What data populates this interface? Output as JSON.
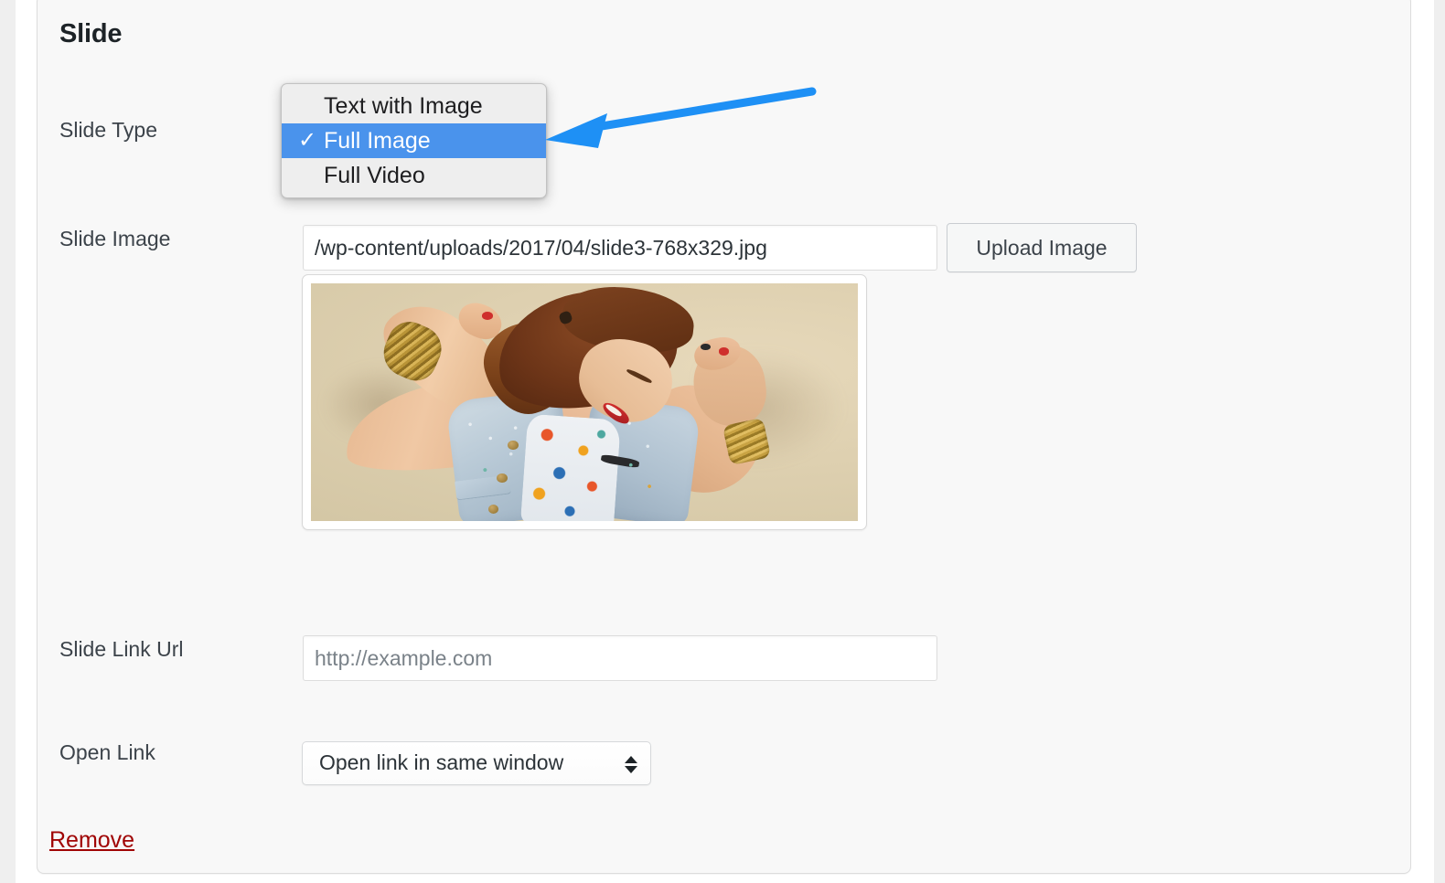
{
  "card": {
    "title": "Slide"
  },
  "fields": {
    "slide_type": {
      "label": "Slide Type",
      "selected": "Full Image",
      "options": [
        {
          "label": "Text with Image",
          "selected": false
        },
        {
          "label": "Full Image",
          "selected": true
        },
        {
          "label": "Full Video",
          "selected": false
        }
      ],
      "check_glyph": "✓"
    },
    "slide_image": {
      "label": "Slide Image",
      "value": "/wp-content/uploads/2017/04/slide3-768x329.jpg",
      "placeholder": "",
      "upload_button": "Upload Image",
      "thumbnail_alt": "Woman flexing both arms, denim vest, floral dress"
    },
    "slide_link_url": {
      "label": "Slide Link Url",
      "value": "",
      "placeholder": "http://example.com"
    },
    "open_link": {
      "label": "Open Link",
      "selected": "Open link in same window",
      "arrow_up": "▲",
      "arrow_down": "▼"
    }
  },
  "actions": {
    "remove": "Remove"
  },
  "colors": {
    "highlight_blue": "#4a93ec",
    "annotation_arrow": "#1e90f5",
    "remove_link": "#a00505",
    "card_background": "#f8f8f8",
    "label_text": "#3c434a",
    "title_text": "#1d2327"
  }
}
